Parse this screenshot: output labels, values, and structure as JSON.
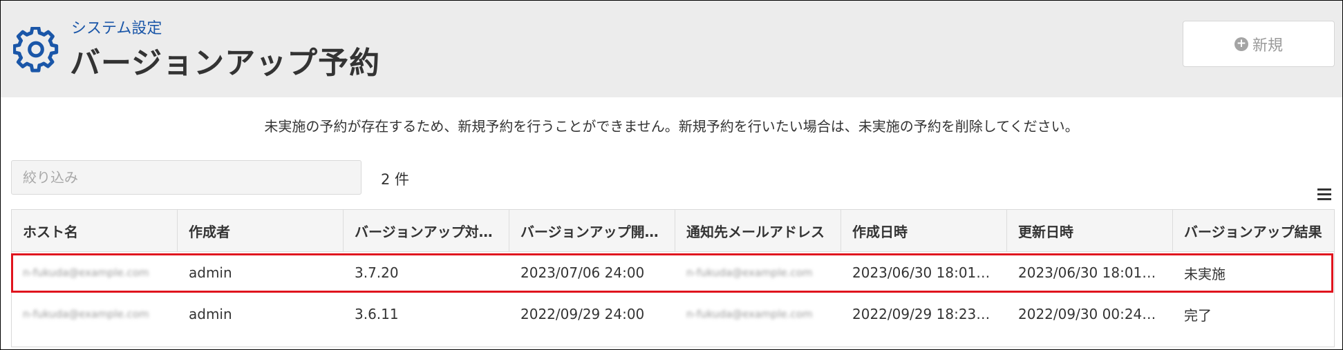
{
  "header": {
    "subtitle": "システム設定",
    "title": "バージョンアップ予約",
    "new_button_label": "新規"
  },
  "notice": "未実施の予約が存在するため、新規予約を行うことができません。新規予約を行いたい場合は、未実施の予約を削除してください。",
  "filter": {
    "placeholder": "絞り込み",
    "value": ""
  },
  "count_label": "2 件",
  "table": {
    "columns": [
      "ホスト名",
      "作成者",
      "バージョンアップ対…",
      "バージョンアップ開…",
      "通知先メールアドレス",
      "作成日時",
      "更新日時",
      "バージョンアップ結果"
    ],
    "rows": [
      {
        "host": "n-fukuda@example.com",
        "creator": "admin",
        "target_version": "3.7.20",
        "start_at": "2023/07/06 24:00",
        "notify_email": "n-fukuda@example.com",
        "created_at": "2023/06/30 18:01…",
        "updated_at": "2023/06/30 18:01…",
        "result": "未実施"
      },
      {
        "host": "n-fukuda@example.com",
        "creator": "admin",
        "target_version": "3.6.11",
        "start_at": "2022/09/29 24:00",
        "notify_email": "n-fukuda@example.com",
        "created_at": "2022/09/29 18:23…",
        "updated_at": "2022/09/30 00:24…",
        "result": "完了"
      }
    ]
  },
  "colors": {
    "accent": "#1a56a8",
    "highlight_border": "#e0141e",
    "header_bg": "#ececec"
  }
}
